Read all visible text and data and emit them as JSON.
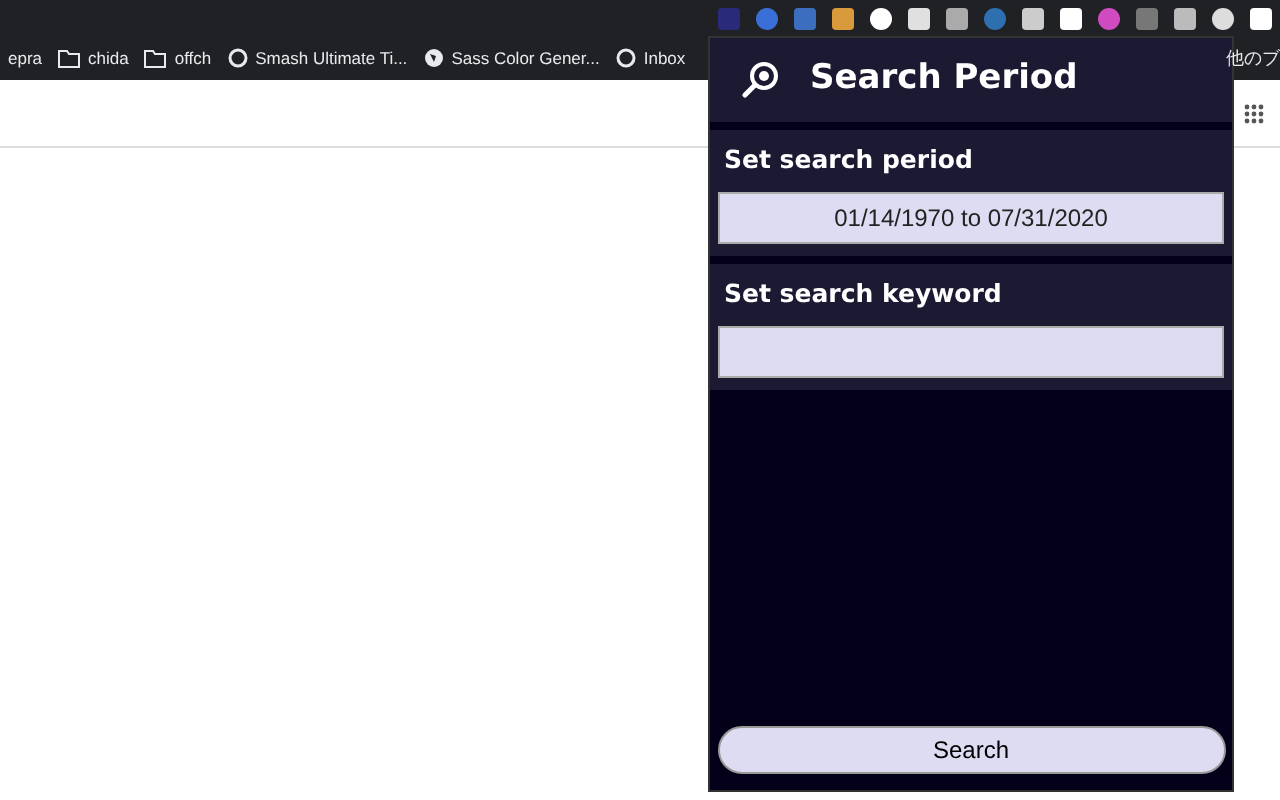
{
  "bookmarks": [
    {
      "kind": "plain",
      "label": "epra"
    },
    {
      "kind": "folder",
      "label": "chida"
    },
    {
      "kind": "folder",
      "label": "offch"
    },
    {
      "kind": "site",
      "label": "Smash Ultimate Ti..."
    },
    {
      "kind": "globe",
      "label": "Sass Color Gener..."
    },
    {
      "kind": "site",
      "label": "Inbox"
    }
  ],
  "other_bookmarks": "他のブ",
  "popup": {
    "title": "Search Period",
    "sections": [
      {
        "label": "Set search period",
        "value": "01/14/1970 to 07/31/2020"
      },
      {
        "label": "Set search keyword"
      }
    ],
    "button": "Search"
  }
}
